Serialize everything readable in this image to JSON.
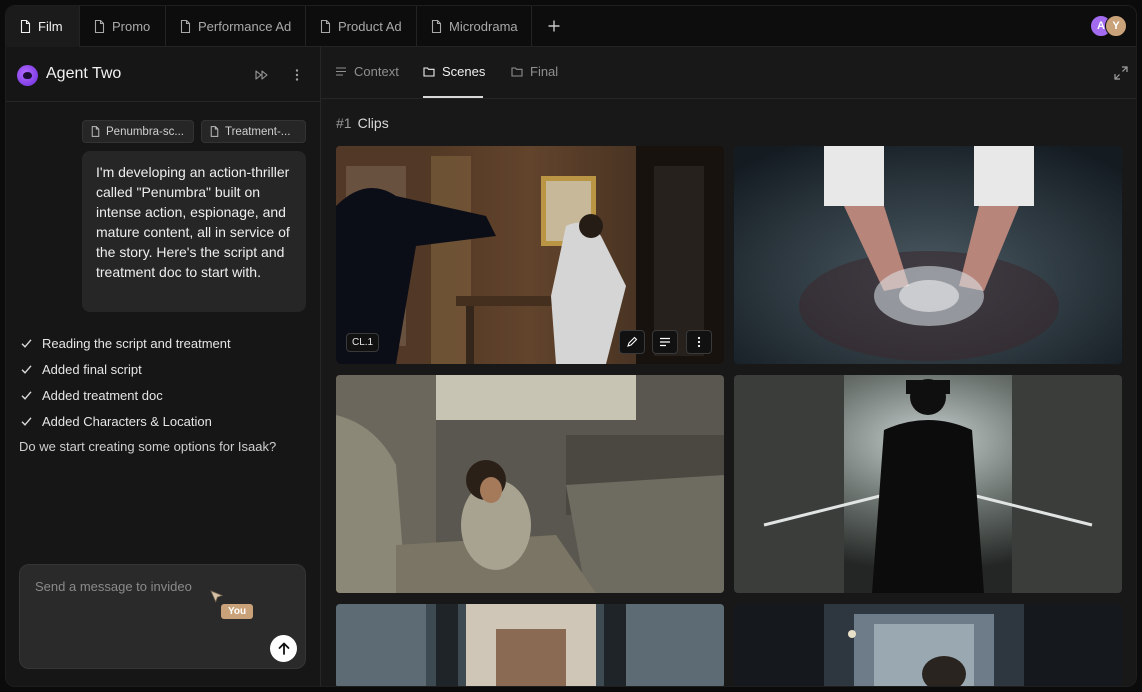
{
  "tabs": [
    {
      "label": "Film",
      "active": true
    },
    {
      "label": "Promo",
      "active": false
    },
    {
      "label": "Performance Ad",
      "active": false
    },
    {
      "label": "Product Ad",
      "active": false
    },
    {
      "label": "Microdrama",
      "active": false
    }
  ],
  "avatars": [
    {
      "initial": "A",
      "color": "#a26bf0"
    },
    {
      "initial": "Y",
      "color": "#c9a27a"
    }
  ],
  "agent": {
    "title": "Agent Two",
    "attachments": [
      "Penumbra-sc...",
      "Treatment-..."
    ],
    "message": "I'm developing an action-thriller called \"Penumbra\" built on intense action, espionage, and mature content, all in service of the story. Here's the script and treatment doc to start with.",
    "steps": [
      "Reading the script and treatment",
      "Added final script",
      "Added treatment doc",
      "Added Characters & Location"
    ],
    "question": "Do we start creating some options for Isaak?",
    "composer_placeholder": "Send a message to invideo",
    "cursor_badge": "You"
  },
  "subtabs": [
    {
      "label": "Context",
      "icon": "list-icon",
      "active": false
    },
    {
      "label": "Scenes",
      "icon": "folder-icon",
      "active": true
    },
    {
      "label": "Final",
      "icon": "folder-icon",
      "active": false
    }
  ],
  "section": {
    "number": "#1",
    "title": "Clips"
  },
  "clips": [
    {
      "label": "CL.1",
      "scene": "fight-in-hotel-room"
    },
    {
      "scene": "hands-in-water"
    },
    {
      "scene": "child-in-vehicle"
    },
    {
      "scene": "silhouette-in-alley"
    },
    {
      "scene": "corridor"
    },
    {
      "scene": "mirror-room"
    }
  ]
}
